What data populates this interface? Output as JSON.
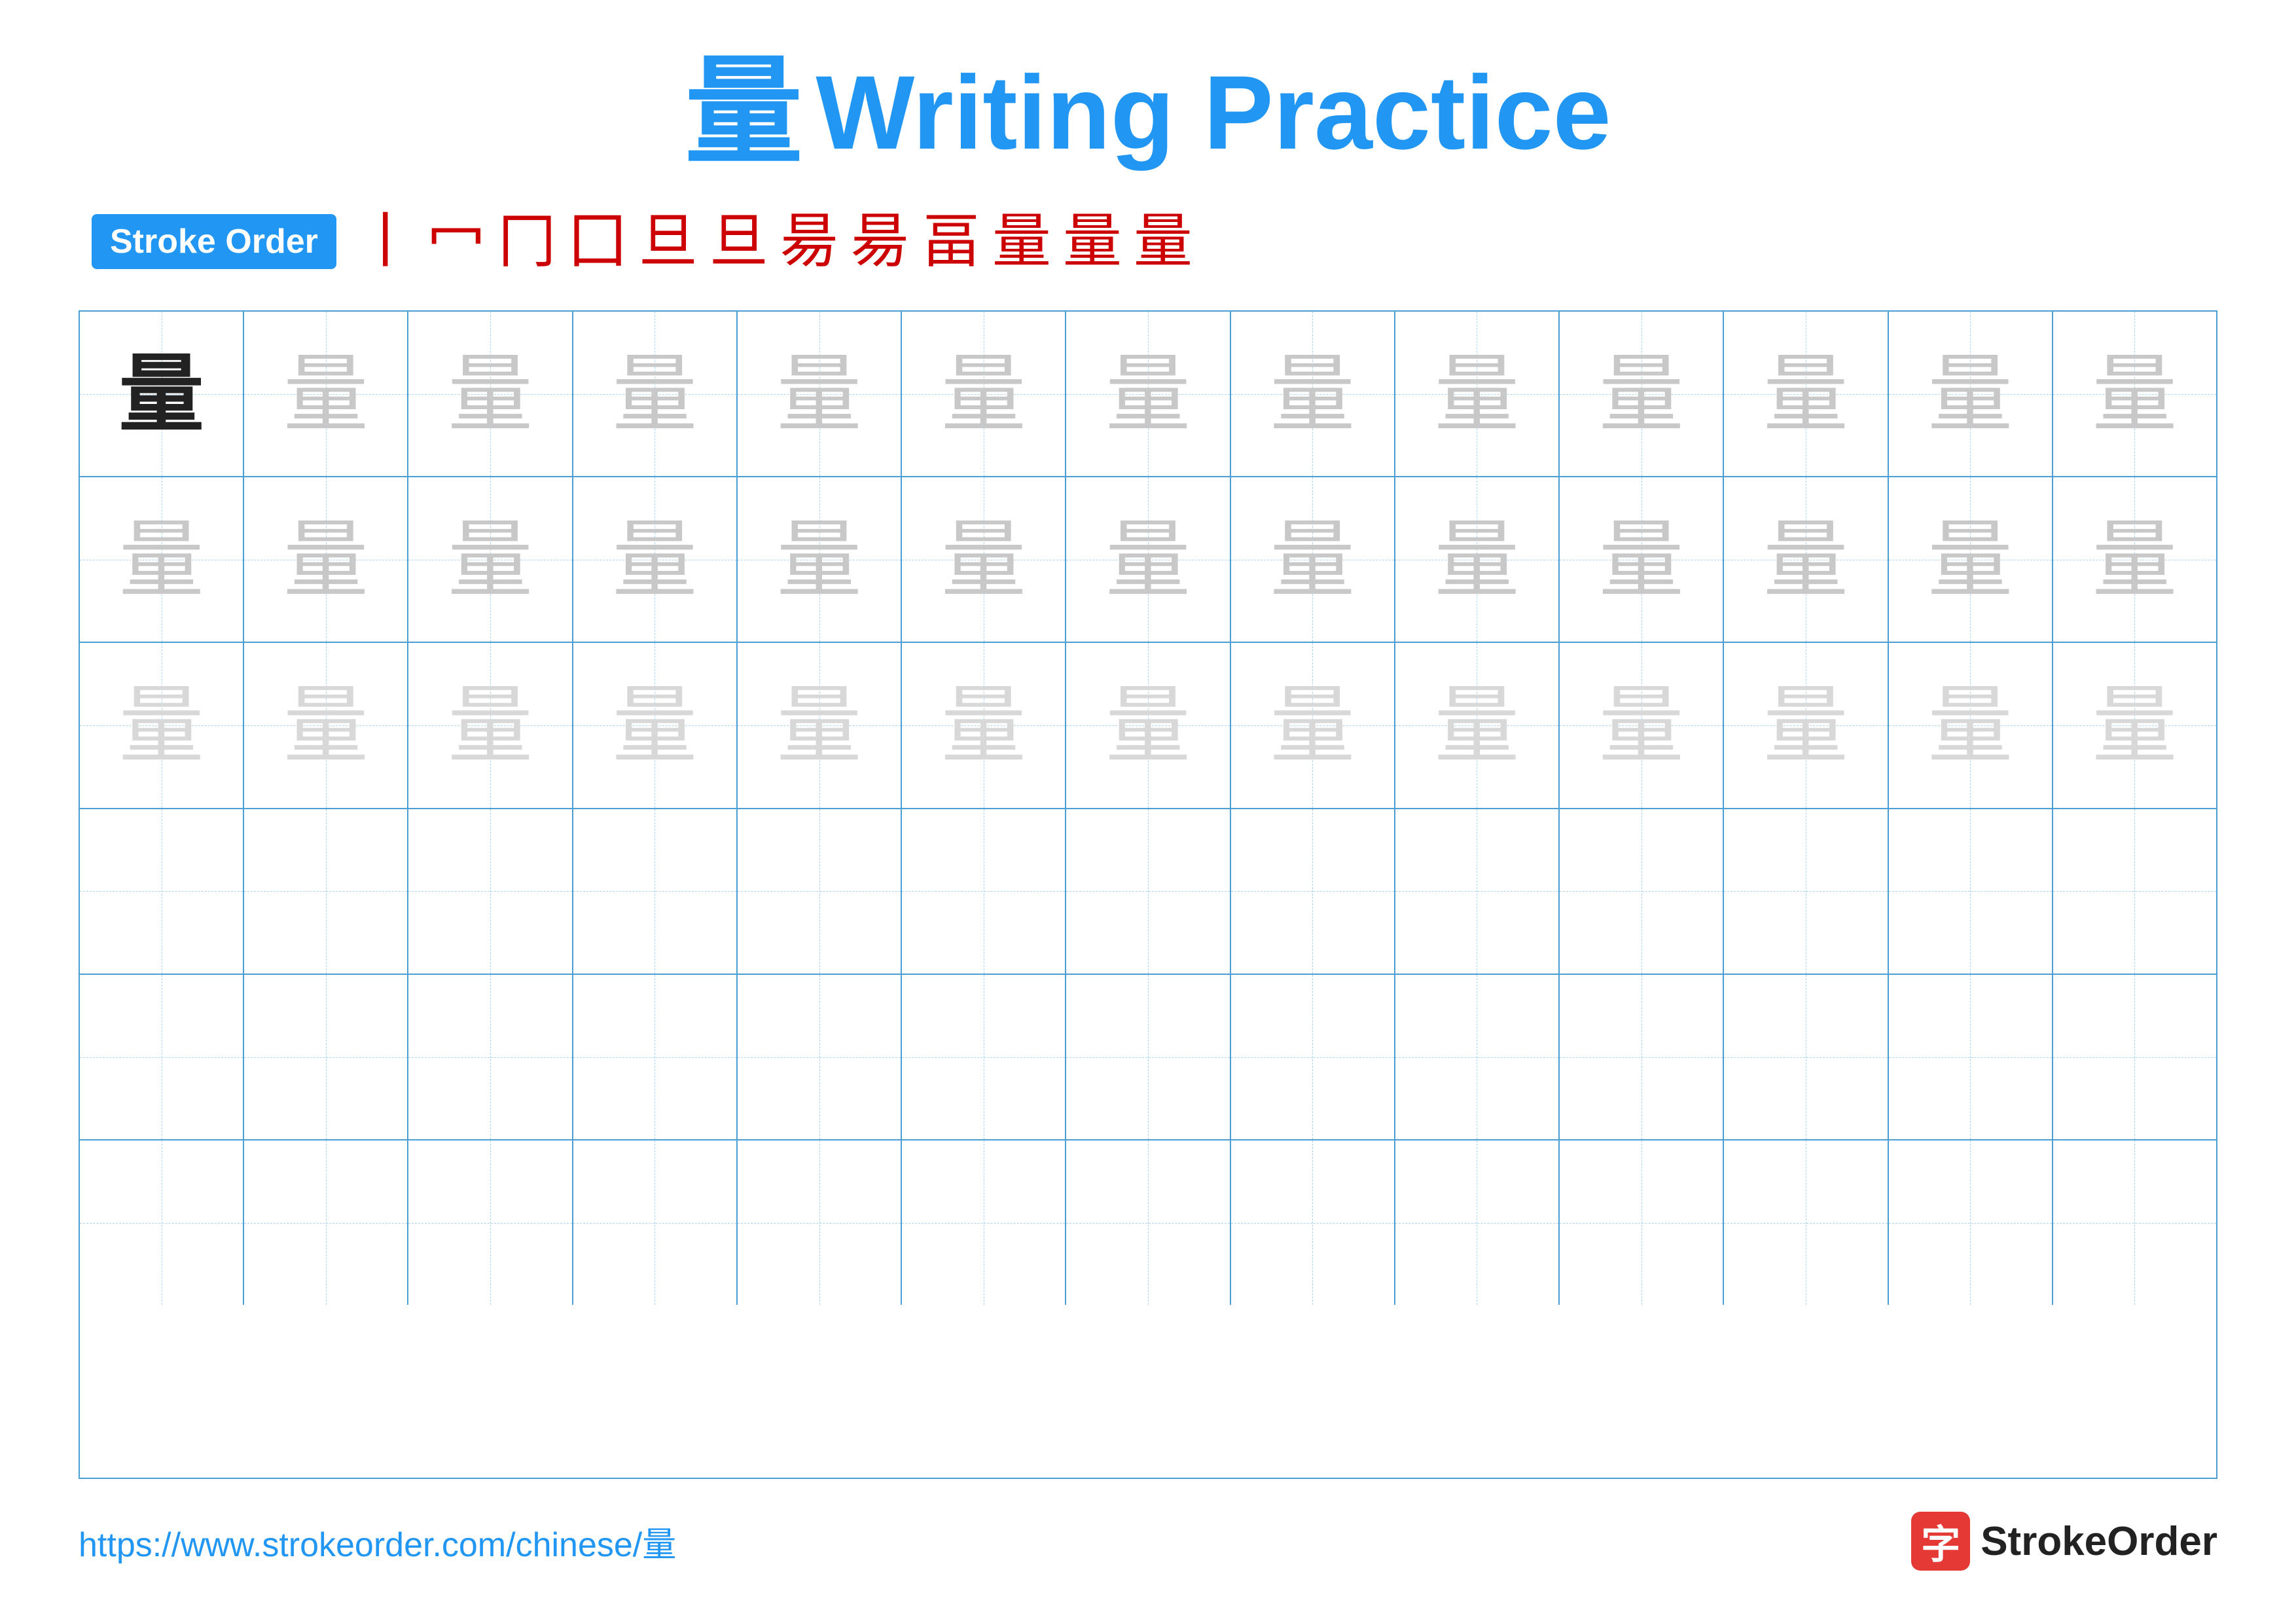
{
  "title": {
    "char": "量",
    "text": "Writing Practice"
  },
  "stroke_order": {
    "badge_label": "Stroke Order",
    "strokes": [
      "丨",
      "冖",
      "冂",
      "囗",
      "旦",
      "旦",
      "昜",
      "昜",
      "畐",
      "量",
      "量",
      "量"
    ]
  },
  "grid": {
    "rows": 6,
    "cols": 13,
    "character": "量",
    "row_styles": [
      [
        "dark",
        "light1",
        "light1",
        "light1",
        "light1",
        "light1",
        "light1",
        "light1",
        "light1",
        "light1",
        "light1",
        "light1",
        "light1"
      ],
      [
        "light1",
        "light1",
        "light1",
        "light1",
        "light1",
        "light1",
        "light1",
        "light1",
        "light1",
        "light1",
        "light1",
        "light1",
        "light1"
      ],
      [
        "light2",
        "light2",
        "light2",
        "light2",
        "light2",
        "light2",
        "light2",
        "light2",
        "light2",
        "light2",
        "light2",
        "light2",
        "light2"
      ],
      [
        "empty",
        "empty",
        "empty",
        "empty",
        "empty",
        "empty",
        "empty",
        "empty",
        "empty",
        "empty",
        "empty",
        "empty",
        "empty"
      ],
      [
        "empty",
        "empty",
        "empty",
        "empty",
        "empty",
        "empty",
        "empty",
        "empty",
        "empty",
        "empty",
        "empty",
        "empty",
        "empty"
      ],
      [
        "empty",
        "empty",
        "empty",
        "empty",
        "empty",
        "empty",
        "empty",
        "empty",
        "empty",
        "empty",
        "empty",
        "empty",
        "empty"
      ]
    ]
  },
  "footer": {
    "url": "https://www.strokeorder.com/chinese/量",
    "logo_text": "StrokeOrder"
  }
}
